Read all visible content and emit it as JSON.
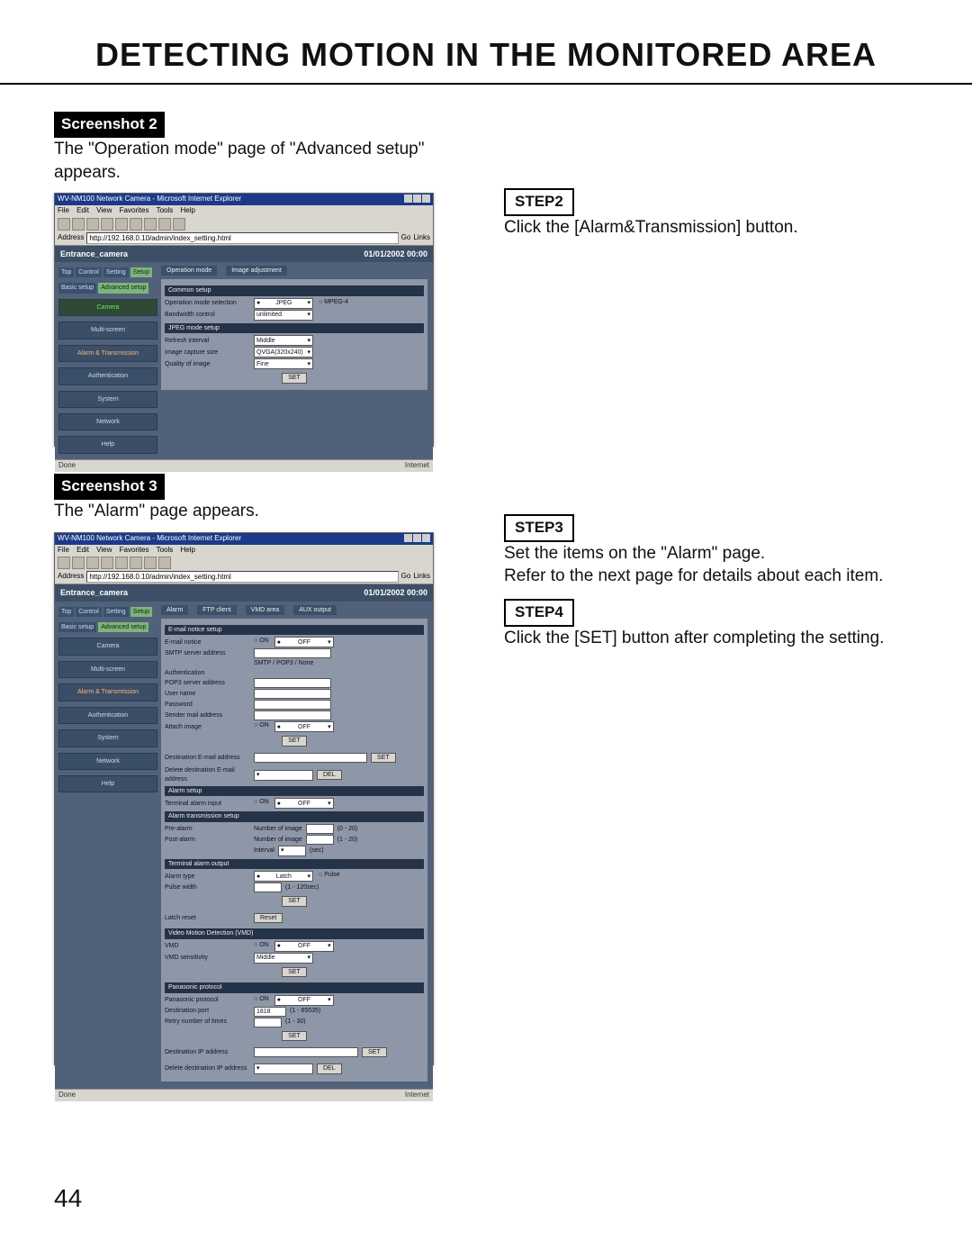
{
  "page_number": "44",
  "title": "DETECTING MOTION IN THE MONITORED AREA",
  "screenshot2": {
    "badge": "Screenshot 2",
    "caption": "The \"Operation mode\" page of \"Advanced setup\" appears.",
    "browser": {
      "window_title": "WV-NM100 Network Camera - Microsoft Internet Explorer",
      "menu": [
        "File",
        "Edit",
        "View",
        "Favorites",
        "Tools",
        "Help"
      ],
      "address_label": "Address",
      "address_value": "http://192.168.0.10/admin/index_setting.html",
      "go": "Go",
      "links": "Links"
    },
    "app_header": {
      "title": "Entrance_camera",
      "timestamp": "01/01/2002  00:00"
    },
    "top_tabs": [
      "Top",
      "Control",
      "Setting",
      "Setup"
    ],
    "sub_tabs_1": [
      "Basic setup",
      "Advanced setup"
    ],
    "sidebar": [
      "Camera",
      "Multi-screen",
      "Alarm & Transmission",
      "Authentication",
      "System",
      "Network",
      "Help"
    ],
    "main_tabs": [
      "Operation mode",
      "Image adjustment"
    ],
    "sections": {
      "common": {
        "heading": "Common setup",
        "mode_label": "Operation mode selection",
        "mode_options": [
          "JPEG",
          "MPEG-4"
        ],
        "bw_label": "Bandwidth control",
        "bw_value": "unlimited"
      },
      "jpeg": {
        "heading": "JPEG mode setup",
        "refresh_label": "Refresh interval",
        "refresh_value": "Middle",
        "size_label": "Image capture size",
        "size_value": "QVGA(320x240)",
        "quality_label": "Quality of image",
        "quality_value": "Fine"
      },
      "set": "SET"
    },
    "status": {
      "left": "Done",
      "right": "Internet"
    }
  },
  "step2": {
    "label": "STEP2",
    "text": "Click the [Alarm&Transmission] button."
  },
  "screenshot3": {
    "badge": "Screenshot 3",
    "caption": "The \"Alarm\" page appears.",
    "browser": {
      "window_title": "WV-NM100 Network Camera - Microsoft Internet Explorer",
      "menu": [
        "File",
        "Edit",
        "View",
        "Favorites",
        "Tools",
        "Help"
      ],
      "address_label": "Address",
      "address_value": "http://192.168.0.10/admin/index_setting.html",
      "go": "Go",
      "links": "Links"
    },
    "app_header": {
      "title": "Entrance_camera",
      "timestamp": "01/01/2002  00:00"
    },
    "top_tabs": [
      "Top",
      "Control",
      "Setting",
      "Setup"
    ],
    "sub_tabs_1": [
      "Basic setup",
      "Advanced setup"
    ],
    "sidebar": [
      "Camera",
      "Multi-screen",
      "Alarm & Transmission",
      "Authentication",
      "System",
      "Network",
      "Help"
    ],
    "main_tabs": [
      "Alarm",
      "FTP client",
      "VMD area",
      "AUX output"
    ],
    "email": {
      "heading": "E-mail notice setup",
      "notice_label": "E-mail notice",
      "onoff": [
        "ON",
        "OFF"
      ],
      "smtp_label": "SMTP server address",
      "auth_hint": "SMTP / POP3 / None",
      "auth_label": "Authentication",
      "pop3_label": "POP3 server address",
      "user_label": "User name",
      "pass_label": "Password",
      "sender_label": "Sender mail address",
      "attach_label": "Attach image",
      "set": "SET",
      "dest_label": "Destination E-mail address",
      "del_dest_label": "Delete destination E-mail address",
      "del": "DEL"
    },
    "alarm": {
      "heading": "Alarm setup",
      "term_label": "Terminal alarm input",
      "onoff": [
        "ON",
        "OFF"
      ],
      "trans_heading": "Alarm transmission setup",
      "pre_label": "Pre-alarm",
      "post_label": "Post-alarm",
      "numimg_label": "Number of image",
      "numimg_hint": "(0 - 20)",
      "postnum_hint": "(1 - 20)",
      "interval_label": "Interval",
      "interval_unit": "(sec)",
      "term_out_heading": "Terminal alarm output",
      "type_label": "Alarm type",
      "type_options": [
        "Latch",
        "Pulse"
      ],
      "pulse_label": "Pulse width",
      "pulse_hint": "(1 - 120sec)",
      "set": "SET",
      "latch_label": "Latch reset",
      "reset": "Reset"
    },
    "vmd": {
      "heading": "Video Motion Detection (VMD)",
      "vmd_label": "VMD",
      "onoff": [
        "ON",
        "OFF"
      ],
      "sens_label": "VMD sensitivity",
      "sens_value": "Middle",
      "set": "SET"
    },
    "pana": {
      "heading": "Panasonic protocol",
      "proto_label": "Panasonic protocol",
      "onoff": [
        "ON",
        "OFF"
      ],
      "port_label": "Destination port",
      "port_value": "1818",
      "port_hint": "(1 - 65535)",
      "retry_label": "Retry number of times",
      "retry_hint": "(1 - 30)",
      "set": "SET",
      "dest_label": "Destination IP address",
      "del_dest_label": "Delete destination IP address",
      "del": "DEL"
    },
    "status": {
      "left": "Done",
      "right": "Internet"
    }
  },
  "step3": {
    "label": "STEP3",
    "line1": "Set the items on the \"Alarm\" page.",
    "line2": "Refer to the next page for details about each item."
  },
  "step4": {
    "label": "STEP4",
    "text": "Click the [SET] button after completing the setting."
  }
}
